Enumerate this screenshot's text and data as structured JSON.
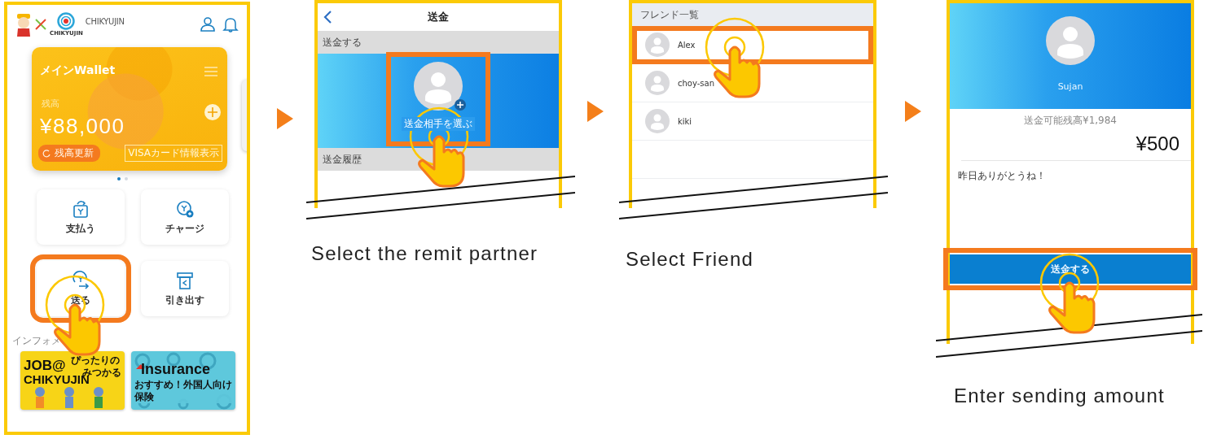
{
  "home": {
    "logo_text": "CHIKYUJIN",
    "logo_subtext": "CHIKYUJIN",
    "wallet": {
      "title": "メインWallet",
      "balance_label": "残高",
      "balance": "¥88,000",
      "refresh_button": "残高更新",
      "visa_button": "VISAカード情報表示"
    },
    "pager": [
      {
        "selected": true
      },
      {
        "selected": false
      }
    ],
    "actions": [
      {
        "kind": "pay",
        "label": "支払う",
        "selected": false
      },
      {
        "kind": "charge",
        "label": "チャージ",
        "selected": false
      },
      {
        "kind": "send",
        "label": "送る",
        "selected": true
      },
      {
        "kind": "withdraw",
        "label": "引き出す",
        "selected": false
      }
    ],
    "info_label": "インフォメ",
    "banners": [
      {
        "kind": "job",
        "title": "JOB@",
        "subtitle": "CHIKYUJIN",
        "tagline_1": "ぴったりの",
        "tagline_2": "みつかる"
      },
      {
        "kind": "insurance",
        "title": "Insurance",
        "tagline": "おすすめ！外国人向け保険"
      }
    ]
  },
  "remit": {
    "title": "送金",
    "send_section": "送金する",
    "picker_label": "送金相手を選ぶ",
    "picker_highlighted": true,
    "history_section": "送金履歴",
    "caption": "Select the remit partner"
  },
  "friends": {
    "title": "フレンド一覧",
    "items": [
      {
        "name": "Alex",
        "selected": true
      },
      {
        "name": "choy-san",
        "selected": false
      },
      {
        "name": "kiki",
        "selected": false
      }
    ],
    "caption": "Select Friend"
  },
  "amount": {
    "recipient": "Sujan",
    "available": "送金可能残高¥1,984",
    "amount": "¥500",
    "message": "昨日ありがとうね！",
    "send_button": "送金する",
    "button_highlighted": true,
    "caption": "Enter sending amount"
  }
}
